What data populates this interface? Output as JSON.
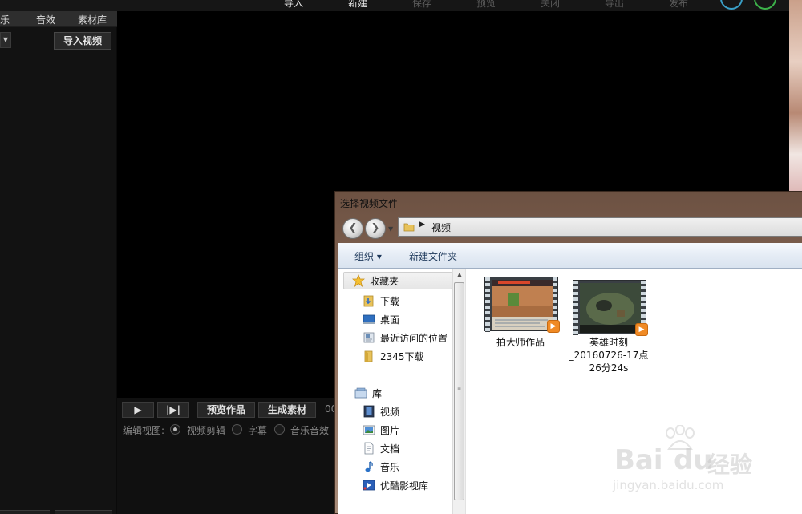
{
  "app": {
    "top_menu": [
      {
        "label": "导入",
        "active": true
      },
      {
        "label": "新建",
        "active": true
      },
      {
        "label": "保存",
        "active": false
      },
      {
        "label": "预览",
        "active": false
      },
      {
        "label": "关闭",
        "active": false
      },
      {
        "label": "导出",
        "active": false
      },
      {
        "label": "发布",
        "active": false
      }
    ],
    "left_tabs": [
      "乐",
      "音效",
      "素材库"
    ],
    "import_video_label": "导入视频",
    "controls": {
      "play": "▶",
      "step": "|▶|",
      "preview": "预览作品",
      "generate": "生成素材",
      "counter": "00"
    },
    "edit_view": {
      "label": "编辑视图:",
      "options": [
        {
          "label": "视频剪辑",
          "checked": true
        },
        {
          "label": "字幕",
          "checked": false
        },
        {
          "label": "音乐音效",
          "checked": false
        }
      ]
    }
  },
  "dialog": {
    "title": "选择视频文件",
    "address": {
      "path": "视频"
    },
    "toolbar": {
      "organize": "组织 ▾",
      "new_folder": "新建文件夹"
    },
    "nav": {
      "favorites": {
        "header": "收藏夹",
        "items": [
          {
            "label": "下载",
            "icon": "download-folder-icon"
          },
          {
            "label": "桌面",
            "icon": "desktop-icon"
          },
          {
            "label": "最近访问的位置",
            "icon": "recent-places-icon"
          },
          {
            "label": "2345下载",
            "icon": "folder-icon"
          }
        ]
      },
      "libraries": {
        "header": "库",
        "items": [
          {
            "label": "视频",
            "icon": "videos-library-icon"
          },
          {
            "label": "图片",
            "icon": "pictures-library-icon"
          },
          {
            "label": "文档",
            "icon": "documents-library-icon"
          },
          {
            "label": "音乐",
            "icon": "music-library-icon"
          },
          {
            "label": "优酷影视库",
            "icon": "youku-library-icon"
          }
        ]
      }
    },
    "files": [
      {
        "name": "拍大师作品",
        "type": "video"
      },
      {
        "name_lines": [
          "英雄时刻",
          "_20160726-17点",
          "26分24s"
        ],
        "type": "video"
      }
    ]
  },
  "watermark": {
    "brand": "Bai",
    "brand2": "du",
    "suffix": "经验",
    "url": "jingyan.baidu.com"
  }
}
